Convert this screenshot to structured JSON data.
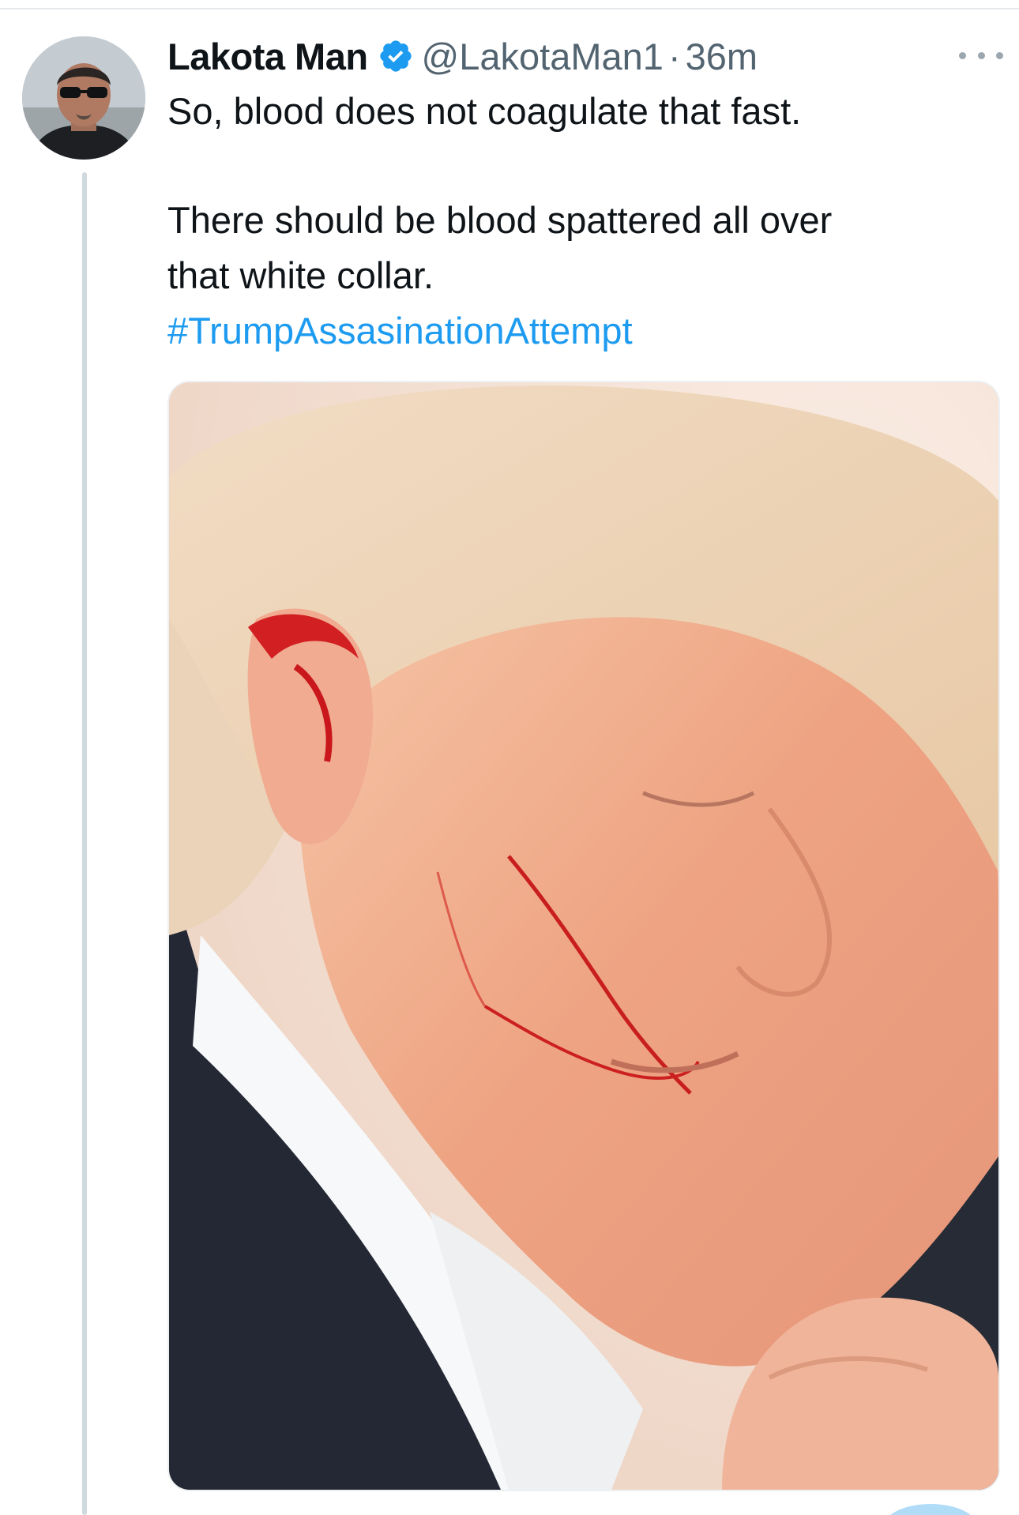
{
  "tweet": {
    "display_name": "Lakota Man",
    "handle": "@LakotaMan1",
    "separator": "·",
    "time": "36m",
    "verified": true,
    "text_lines": [
      "So, blood does not coagulate that fast.",
      "There should be blood spattered all over",
      "that white collar."
    ],
    "hashtag": "#TrumpAssasinationAttempt",
    "icons": {
      "verified": "verified-badge-icon",
      "more": "more-options-icon"
    }
  },
  "colors": {
    "text": "#0f1419",
    "secondary": "#536471",
    "link": "#1d9bf0",
    "verified": "#1d9bf0",
    "thread_line": "#cfd9de"
  }
}
